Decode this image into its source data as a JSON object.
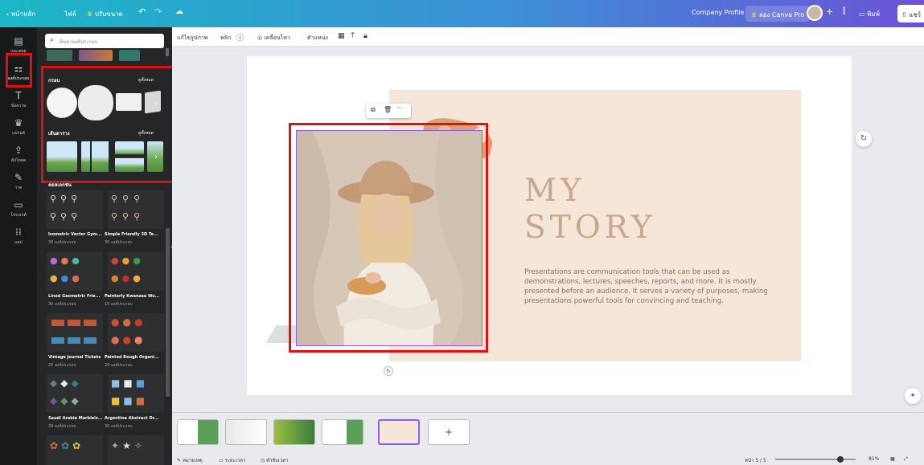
{
  "topbar": {
    "home": "หน้าหลัก",
    "file": "ไฟล์",
    "resize": "ปรับขนาด",
    "undo_icon": "undo-icon",
    "redo_icon": "redo-icon",
    "doc_title": "Company Profile",
    "try_pro": "ลอง Canva Pro",
    "print": "พิมพ์",
    "share": "แชร์"
  },
  "rail": [
    {
      "label": "เทมเพลต",
      "icon": "template-icon",
      "glyph": "▤"
    },
    {
      "label": "องค์ประกอบ",
      "icon": "elements-icon",
      "glyph": "⚏"
    },
    {
      "label": "ข้อความ",
      "icon": "text-icon",
      "glyph": "T"
    },
    {
      "label": "แบรนด์",
      "icon": "brand-icon",
      "glyph": "♛"
    },
    {
      "label": "อัปโหลด",
      "icon": "upload-icon",
      "glyph": "⇪"
    },
    {
      "label": "วาด",
      "icon": "draw-icon",
      "glyph": "✎"
    },
    {
      "label": "โปรเจกต์",
      "icon": "folder-icon",
      "glyph": "▭"
    },
    {
      "label": "แอป",
      "icon": "apps-icon",
      "glyph": "⁞⁞"
    }
  ],
  "panel": {
    "search_placeholder": "ค้นหาองค์ประกอบ",
    "frames_title": "กรอบ",
    "frames_see_all": "ดูทั้งหมด",
    "grids_title": "เส้นตาราง",
    "grids_see_all": "ดูทั้งหมด",
    "collections_title": "คอลเลกชัน",
    "packs": [
      {
        "name": "Isometric Vector Gym...",
        "count": "30 องค์ประกอบ"
      },
      {
        "name": "Simple Friendly 3D Te...",
        "count": "30 องค์ประกอบ"
      },
      {
        "name": "Lined Geometric Frie...",
        "count": "30 องค์ประกอบ"
      },
      {
        "name": "Painterly Kwanzaa Wo...",
        "count": "15 องค์ประกอบ"
      },
      {
        "name": "Vintage Journal Tickets",
        "count": "25 องค์ประกอบ"
      },
      {
        "name": "Painted Rough Organi...",
        "count": "29 องค์ประกอบ"
      },
      {
        "name": "Saudi Arabia Marbleiz...",
        "count": "29 องค์ประกอบ"
      },
      {
        "name": "Argentina Abstract Or...",
        "count": "30 องค์ประกอบ"
      }
    ]
  },
  "toolbar2": {
    "edit_image": "แก้ไขรูปภาพ",
    "flip": "พลิก",
    "position_icon": "info-icon",
    "crop_icon": "crop-icon",
    "animate": "เคลื่อนไหว",
    "position": "ตำแหน่ง",
    "transparency_icon": "transparency-icon",
    "copy_style_icon": "paint-roller-icon",
    "lock_icon": "lock-icon"
  },
  "slide": {
    "title_line1": "MY",
    "title_line2": "STORY",
    "description": "Presentations are communication tools that can be used as demonstrations, lectures, speeches, reports, and more. It is mostly presented before an audience. It serves a variety of purposes, making presentations powerful tools for convincing and teaching."
  },
  "bottom": {
    "notes": "หมายเหตุ",
    "duration": "ระยะเวลา",
    "timer": "ตัวจับเวลา",
    "page_indicator": "หน้า 5 / 5",
    "zoom": "81%",
    "zoom_level": 0.81,
    "add_page": "+"
  },
  "colors": {
    "topbar_start": "#1bb7c6",
    "topbar_end": "#6b52d6",
    "highlight": "#e01010",
    "slide_accent": "#c7a78d",
    "panel_bg": "#252627"
  }
}
